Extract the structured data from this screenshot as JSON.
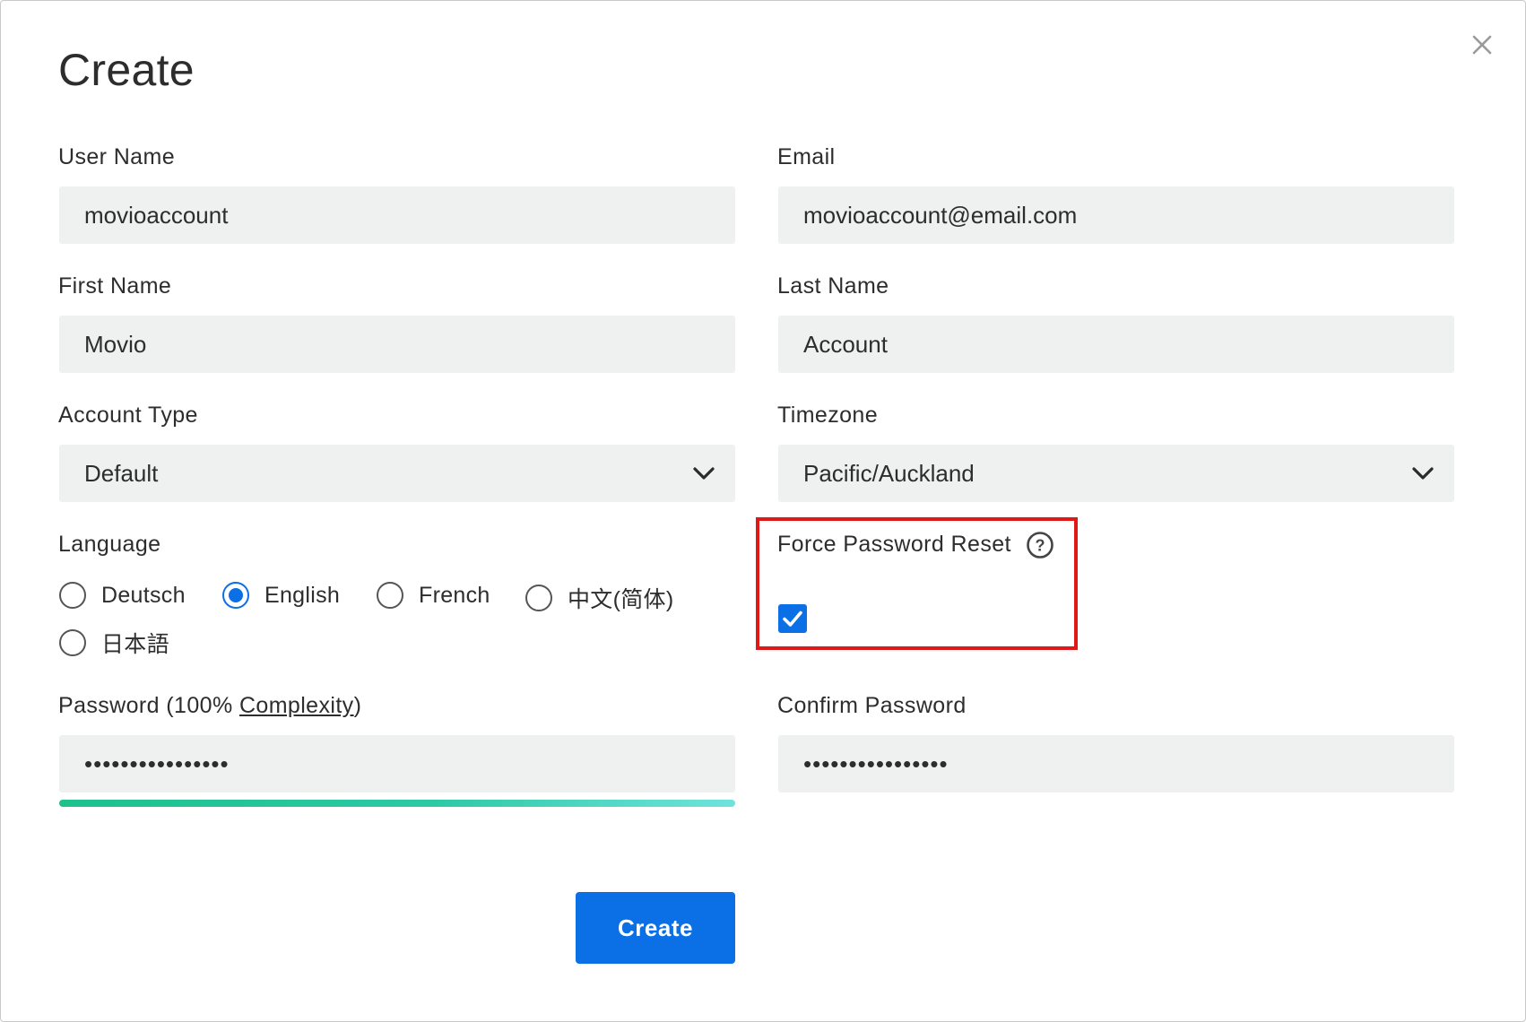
{
  "dialog": {
    "title": "Create",
    "close_icon": "close-icon"
  },
  "form": {
    "user_name": {
      "label": "User Name",
      "value": "movioaccount"
    },
    "email": {
      "label": "Email",
      "value": "movioaccount@email.com"
    },
    "first_name": {
      "label": "First Name",
      "value": "Movio"
    },
    "last_name": {
      "label": "Last Name",
      "value": "Account"
    },
    "account_type": {
      "label": "Account Type",
      "value": "Default",
      "icon": "chevron-down-icon"
    },
    "timezone": {
      "label": "Timezone",
      "value": "Pacific/Auckland",
      "icon": "chevron-down-icon"
    },
    "language": {
      "label": "Language",
      "options": [
        {
          "label": "Deutsch",
          "selected": false
        },
        {
          "label": "English",
          "selected": true
        },
        {
          "label": "French",
          "selected": false
        },
        {
          "label": "中文(简体)",
          "selected": false
        },
        {
          "label": "日本語",
          "selected": false
        }
      ]
    },
    "force_password_reset": {
      "label": "Force Password Reset",
      "checked": true,
      "help_icon": "question-circle-icon"
    },
    "password": {
      "label_prefix": "Password (100% ",
      "label_link": "Complexity",
      "label_suffix": ")",
      "value": "••••••••••••••••",
      "complexity_percent": 100
    },
    "confirm_password": {
      "label": "Confirm Password",
      "value": "••••••••••••••••"
    }
  },
  "actions": {
    "create_label": "Create"
  },
  "colors": {
    "accent": "#0b6fe6",
    "field_bg": "#eff0f0",
    "highlight": "#e01818",
    "strength_start": "#1ec08c",
    "strength_end": "#6fe3dc"
  }
}
